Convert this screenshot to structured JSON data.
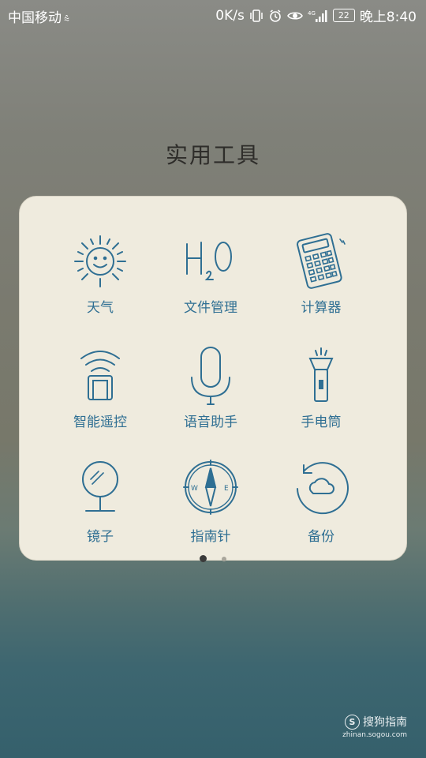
{
  "status_bar": {
    "carrier": "中国移动",
    "carrier_extra": "⁴ᵍ",
    "speed": "0K/s",
    "network": "4G",
    "battery": "22",
    "time": "晚上8:40"
  },
  "folder": {
    "title": "实用工具",
    "apps": [
      {
        "label": "天气",
        "icon": "sun-icon"
      },
      {
        "label": "文件管理",
        "icon": "h2o-icon"
      },
      {
        "label": "计算器",
        "icon": "calculator-icon"
      },
      {
        "label": "智能遥控",
        "icon": "remote-icon"
      },
      {
        "label": "语音助手",
        "icon": "microphone-icon"
      },
      {
        "label": "手电筒",
        "icon": "flashlight-icon"
      },
      {
        "label": "镜子",
        "icon": "mirror-icon"
      },
      {
        "label": "指南针",
        "icon": "compass-icon"
      },
      {
        "label": "备份",
        "icon": "backup-icon"
      }
    ]
  },
  "pager": {
    "pages": 2,
    "current": 1
  },
  "watermark": {
    "brand": "搜狗指南",
    "url": "zhinan.sogou.com"
  },
  "colors": {
    "icon_stroke": "#2f6f93",
    "panel_bg": "#efebde",
    "title": "#2e2d2a"
  }
}
